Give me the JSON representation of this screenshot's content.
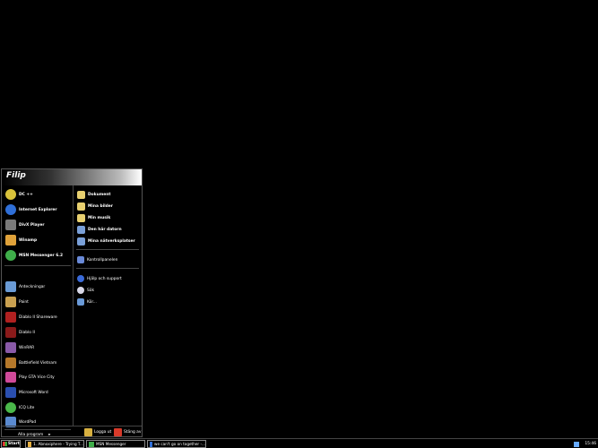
{
  "user": "Filip",
  "pinned": [
    {
      "label": "DC ++",
      "icon": "dcpp-icon",
      "color": "#d9c23a"
    },
    {
      "label": "Internet Explorer",
      "icon": "internet-explorer-icon",
      "color": "#2f6fd8"
    },
    {
      "label": "DivX Player",
      "icon": "divx-player-icon",
      "color": "#7a7a7a"
    },
    {
      "label": "Winamp",
      "icon": "winamp-icon",
      "color": "#e0a23a"
    },
    {
      "label": "MSN Messenger 6.2",
      "icon": "msn-messenger-icon",
      "color": "#3fae4a"
    }
  ],
  "recent": [
    {
      "label": "Anteckningar",
      "icon": "notepad-icon",
      "color": "#6a9bd6"
    },
    {
      "label": "Paint",
      "icon": "paint-icon",
      "color": "#c9a050"
    },
    {
      "label": "Diablo II Shareware",
      "icon": "diablo-shareware-icon",
      "color": "#b02020"
    },
    {
      "label": "Diablo II",
      "icon": "diablo-icon",
      "color": "#8a1a1a"
    },
    {
      "label": "WinRAR",
      "icon": "winrar-icon",
      "color": "#8a5aa8"
    },
    {
      "label": "Battlefield Vietnam",
      "icon": "battlefield-icon",
      "color": "#b5782a"
    },
    {
      "label": "Play GTA Vice City",
      "icon": "gta-vice-city-icon",
      "color": "#d04a9a"
    },
    {
      "label": "Microsoft Word",
      "icon": "word-icon",
      "color": "#2a4fb0"
    },
    {
      "label": "ICQ Lite",
      "icon": "icq-icon",
      "color": "#4ab84a"
    },
    {
      "label": "WordPad",
      "icon": "wordpad-icon",
      "color": "#5a8ad0"
    }
  ],
  "all_programs": "Alla program",
  "all_programs_arrow": "▸",
  "places": [
    {
      "label": "Dokument",
      "icon": "documents-folder-icon",
      "color": "#e8d070"
    },
    {
      "label": "Mina bilder",
      "icon": "pictures-folder-icon",
      "color": "#e8d070"
    },
    {
      "label": "Min musik",
      "icon": "music-folder-icon",
      "color": "#e8d070"
    },
    {
      "label": "Den här datorn",
      "icon": "my-computer-icon",
      "color": "#7aa0d8"
    },
    {
      "label": "Mina nätverksplatser",
      "icon": "network-places-icon",
      "color": "#7aa0d8"
    }
  ],
  "system": [
    {
      "label": "Kontrollpanelen",
      "icon": "control-panel-icon",
      "color": "#6a8ad8"
    }
  ],
  "tools": [
    {
      "label": "Hjälp och support",
      "icon": "help-icon",
      "color": "#3a6ad8"
    },
    {
      "label": "Sök",
      "icon": "search-icon",
      "color": "#d8d8e8"
    },
    {
      "label": "Kör...",
      "icon": "run-icon",
      "color": "#6a9ad8"
    }
  ],
  "logoff": "Logga ut",
  "shutdown": "Stäng av",
  "taskbar": {
    "start": "Start",
    "tasks": [
      {
        "label": "1. Abnoxiphere - Trying T...",
        "color": "#e8b040"
      },
      {
        "label": "MSN Messenger",
        "color": "#3fae4a"
      },
      {
        "label": "we can't go on together -...",
        "color": "#2f6fd8"
      }
    ],
    "clock": "15:46"
  }
}
